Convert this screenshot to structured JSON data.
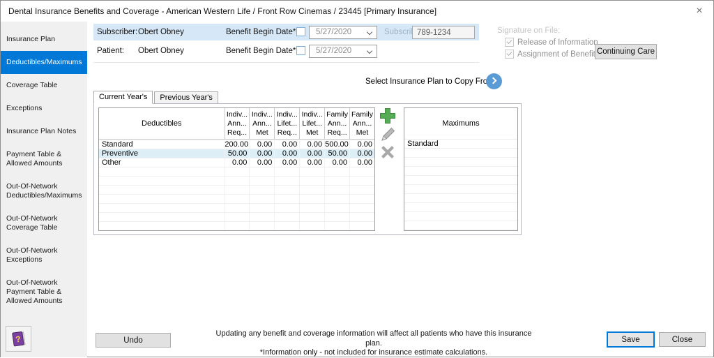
{
  "window": {
    "title": "Dental Insurance Benefits and Coverage - American Western Life / Front Row Cinemas / 23445 [Primary Insurance]",
    "close_glyph": "×"
  },
  "sidebar": {
    "items": [
      {
        "label": "Insurance Plan",
        "selected": false
      },
      {
        "label": "Deductibles/Maximums",
        "selected": true
      },
      {
        "label": "Coverage Table",
        "selected": false
      },
      {
        "label": "Exceptions",
        "selected": false
      },
      {
        "label": "Insurance Plan Notes",
        "selected": false
      },
      {
        "label": "Payment Table &\nAllowed Amounts",
        "selected": false
      },
      {
        "label": "Out-Of-Network\nDeductibles/Maximums",
        "selected": false
      },
      {
        "label": "Out-Of-Network\nCoverage Table",
        "selected": false
      },
      {
        "label": "Out-Of-Network\nExceptions",
        "selected": false
      },
      {
        "label": "Out-Of-Network\nPayment Table &\nAllowed Amounts",
        "selected": false
      }
    ]
  },
  "header": {
    "subscriber": {
      "label": "Subscriber:",
      "name": "Obert Obney",
      "date_label": "Benefit Begin Date*",
      "date_value": "5/27/2020",
      "id_label": "Subscriber ID:",
      "id_value": "789-1234"
    },
    "patient": {
      "label": "Patient:",
      "name": "Obert Obney",
      "date_label": "Benefit Begin Date*",
      "date_value": "5/27/2020"
    },
    "signature": {
      "title": "Signature on File:",
      "release_label": "Release of Information",
      "assignment_label": "Assignment of Benefits",
      "release_checked": true,
      "assignment_checked": true
    },
    "continuing_care_label": "Continuing Care"
  },
  "copy_from": {
    "label": "Select Insurance Plan to Copy From:"
  },
  "tabs": {
    "current": "Current Year's",
    "previous": "Previous Year's",
    "active": "Current Year's"
  },
  "deductibles": {
    "title": "Deductibles",
    "columns": [
      [
        "Indiv...",
        "Ann...",
        "Req..."
      ],
      [
        "Indiv...",
        "Ann...",
        "Met"
      ],
      [
        "Indiv...",
        "Lifet...",
        "Req..."
      ],
      [
        "Indiv...",
        "Lifet...",
        "Met"
      ],
      [
        "Family",
        "Ann...",
        "Req..."
      ],
      [
        "Family",
        "Ann...",
        "Met"
      ]
    ],
    "rows": [
      {
        "label": "Standard",
        "values": [
          "200.00",
          "0.00",
          "0.00",
          "0.00",
          "500.00",
          "0.00"
        ],
        "highlighted": false
      },
      {
        "label": "Preventive",
        "values": [
          "50.00",
          "0.00",
          "0.00",
          "0.00",
          "50.00",
          "0.00"
        ],
        "highlighted": true
      },
      {
        "label": "Other",
        "values": [
          "0.00",
          "0.00",
          "0.00",
          "0.00",
          "0.00",
          "0.00"
        ],
        "highlighted": false
      }
    ]
  },
  "maximums": {
    "title": "Maximums",
    "rows": [
      {
        "label": "Standard"
      }
    ]
  },
  "toolbar": {
    "icons": [
      "add-icon",
      "edit-icon",
      "delete-icon"
    ]
  },
  "footer": {
    "undo_label": "Undo",
    "note_line1": "Updating any benefit and coverage information will affect all patients who have this insurance plan.",
    "note_line2": "*Information only - not included for insurance estimate calculations.",
    "save_label": "Save",
    "close_label": "Close"
  },
  "colors": {
    "accent": "#0078d7",
    "subscriber_row_bg": "#d6e8f8",
    "highlight_row_bg": "#ddeef6",
    "add_icon_green": "#56ab56",
    "copy_button_blue": "#5b9bd5",
    "sidebar_bg": "#f0f0f0"
  }
}
